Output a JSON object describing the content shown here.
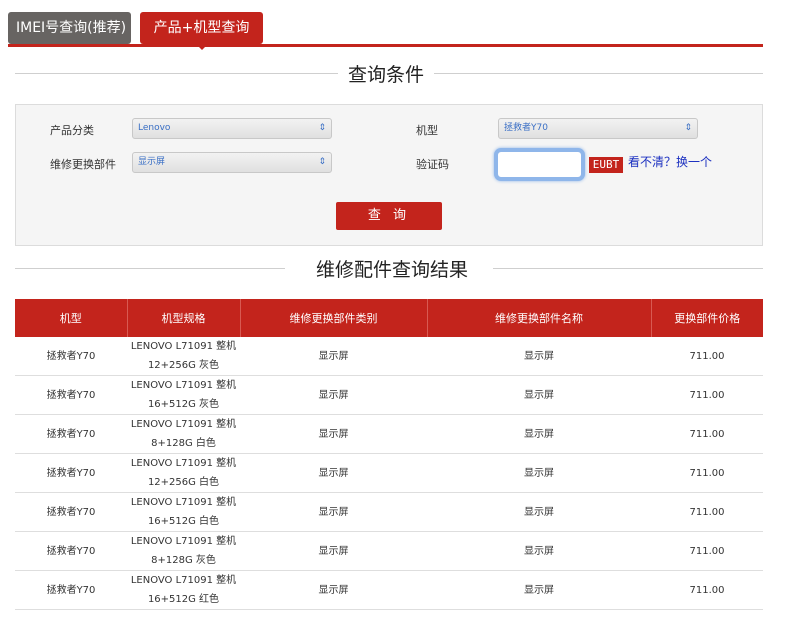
{
  "tabs": [
    {
      "label": "IMEI号查询(推荐)",
      "active": false
    },
    {
      "label": "产品+机型查询",
      "active": true
    }
  ],
  "query_section": {
    "title": "查询条件",
    "product_category": {
      "label": "产品分类",
      "value": "Lenovo"
    },
    "model": {
      "label": "机型",
      "value": "拯救者Y70"
    },
    "repair_part": {
      "label": "维修更换部件",
      "value": "显示屏"
    },
    "captcha": {
      "label": "验证码",
      "value": "",
      "image_text": "EUBT",
      "refresh_label": "看不清？换一个"
    },
    "query_button": "查 询"
  },
  "results_section": {
    "title": "维修配件查询结果",
    "columns": [
      "机型",
      "机型规格",
      "维修更换部件类别",
      "维修更换部件名称",
      "更换部件价格"
    ],
    "rows": [
      [
        "拯救者Y70",
        "LENOVO L71091 整机\n12+256G 灰色",
        "显示屏",
        "显示屏",
        "711.00"
      ],
      [
        "拯救者Y70",
        "LENOVO L71091 整机\n16+512G 灰色",
        "显示屏",
        "显示屏",
        "711.00"
      ],
      [
        "拯救者Y70",
        "LENOVO L71091 整机\n8+128G 白色",
        "显示屏",
        "显示屏",
        "711.00"
      ],
      [
        "拯救者Y70",
        "LENOVO L71091 整机\n12+256G 白色",
        "显示屏",
        "显示屏",
        "711.00"
      ],
      [
        "拯救者Y70",
        "LENOVO L71091 整机\n16+512G 白色",
        "显示屏",
        "显示屏",
        "711.00"
      ],
      [
        "拯救者Y70",
        "LENOVO L71091 整机\n8+128G 灰色",
        "显示屏",
        "显示屏",
        "711.00"
      ],
      [
        "拯救者Y70",
        "LENOVO L71091 整机\n16+512G 红色",
        "显示屏",
        "显示屏",
        "711.00"
      ]
    ]
  },
  "colors": {
    "accent": "#c3241c",
    "tab_inactive": "#676462",
    "captcha_focus": "#8fb6ea",
    "link": "#1a2fc0"
  }
}
